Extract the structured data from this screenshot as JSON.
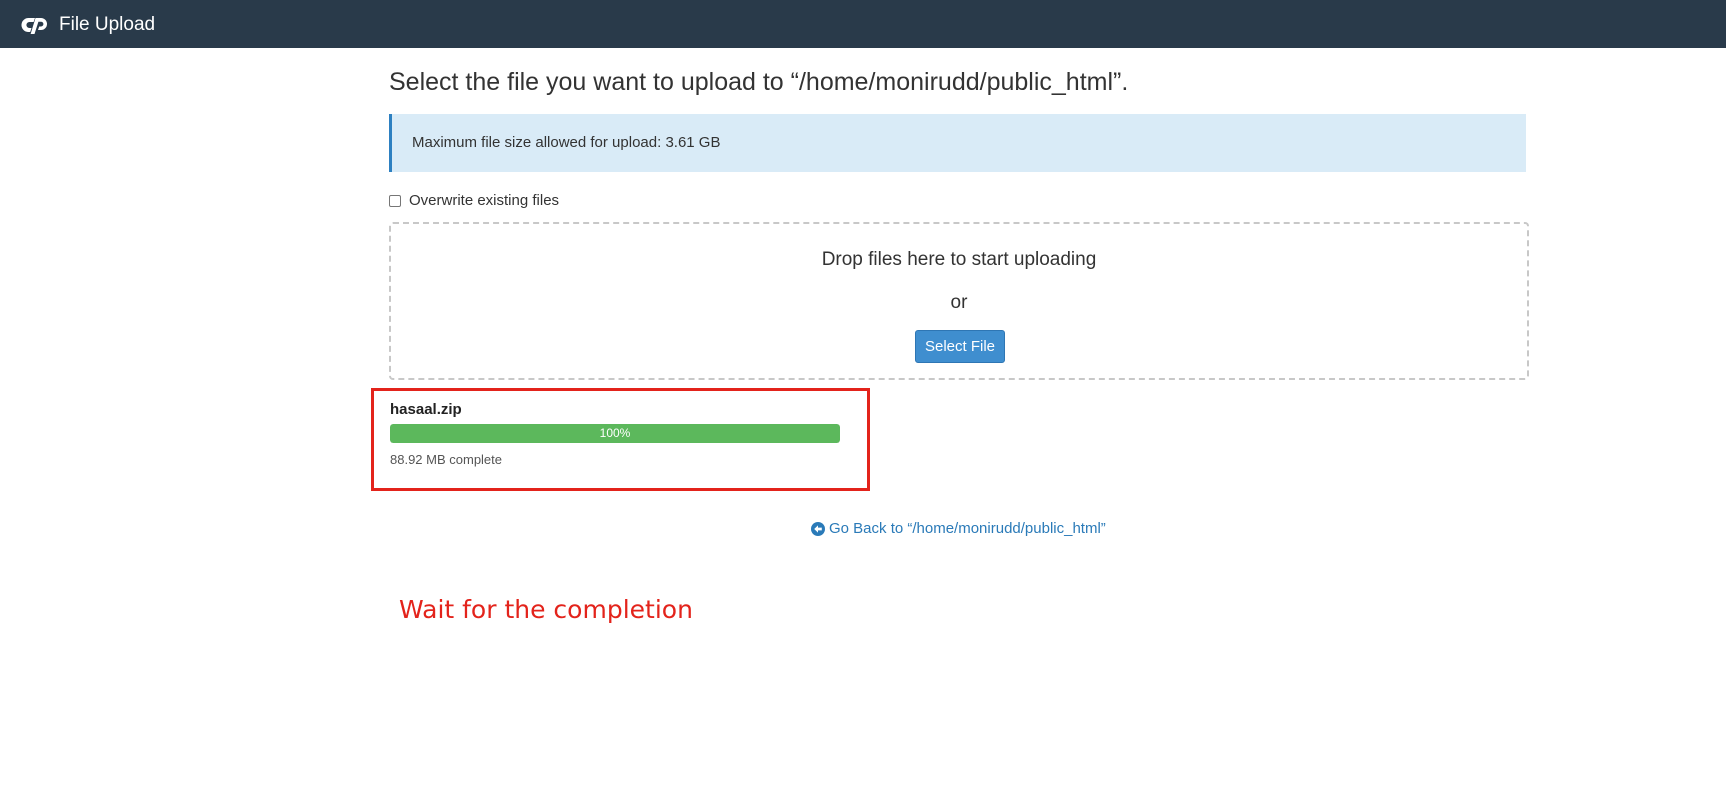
{
  "header": {
    "app_title": "File Upload",
    "logo_icon": "cpanel-logo-icon",
    "background_color": "#293a4a"
  },
  "main": {
    "page_title": "Select the file you want to upload to “/home/monirudd/public_html”.",
    "info_alert": "Maximum file size allowed for upload: 3.61 GB",
    "overwrite_label": "Overwrite existing files",
    "overwrite_checked": false,
    "dropzone": {
      "text": "Drop files here to start uploading",
      "or_text": "or",
      "select_button_label": "Select File"
    },
    "upload": {
      "file_name": "hasaal.zip",
      "progress_percent": 100,
      "progress_label": "100%",
      "status": "88.92 MB complete",
      "progress_color": "#5cb85c"
    },
    "back_link": {
      "icon": "arrow-circle-left-icon",
      "label": "Go Back to “/home/monirudd/public_html”"
    }
  },
  "annotation": {
    "text": "Wait for the completion",
    "color": "#e3231b"
  }
}
